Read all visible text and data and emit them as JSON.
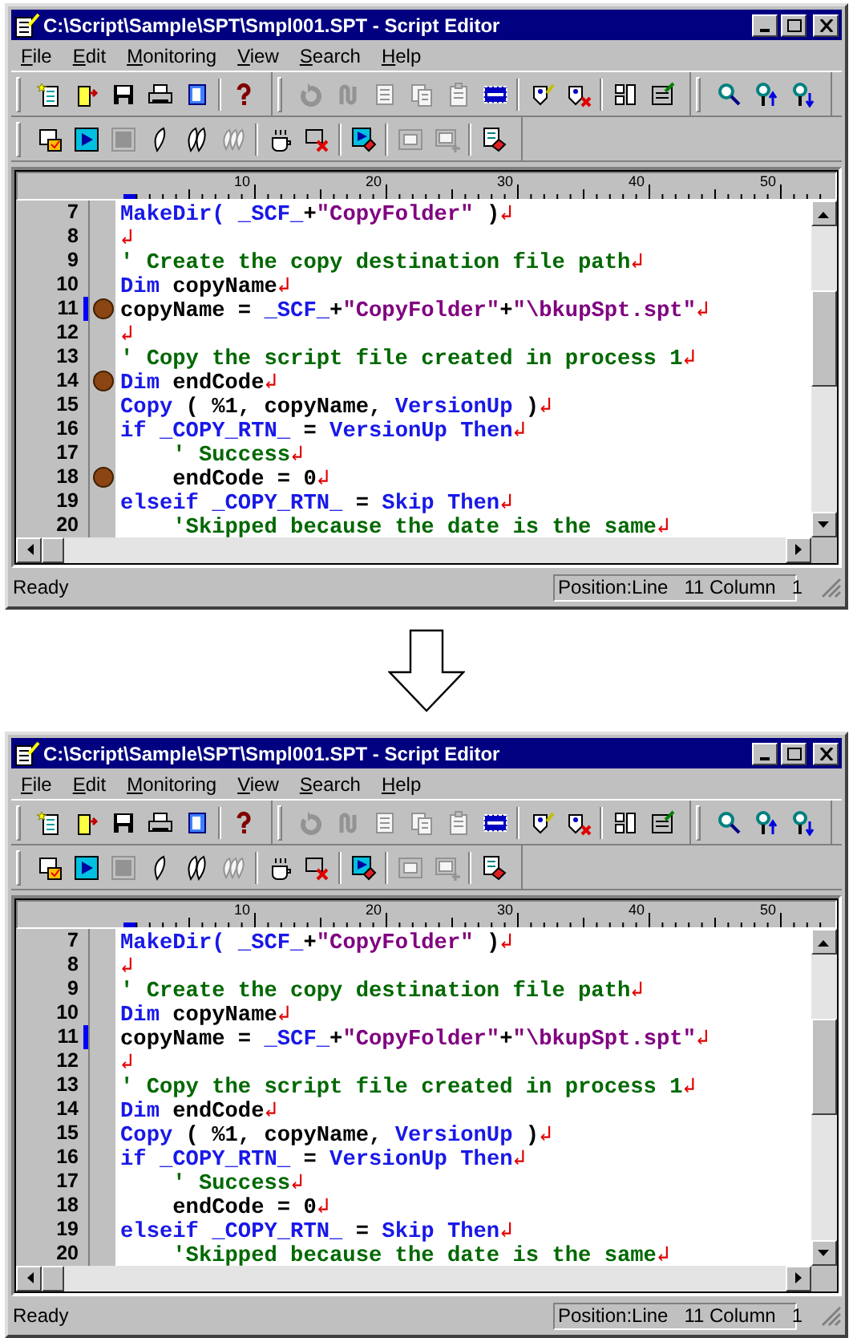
{
  "windows": [
    {
      "title": "C:\\Script\\Sample\\SPT\\Smpl001.SPT - Script Editor",
      "menu": [
        {
          "label": "File"
        },
        {
          "label": "Edit"
        },
        {
          "label": "Monitoring"
        },
        {
          "label": "View"
        },
        {
          "label": "Search"
        },
        {
          "label": "Help"
        }
      ],
      "toolbars": [
        {
          "bands": [
            {
              "groups": [
                [
                  {
                    "kind": "new",
                    "disabled": false
                  },
                  {
                    "kind": "open",
                    "disabled": false
                  },
                  {
                    "kind": "save",
                    "disabled": false
                  },
                  {
                    "kind": "print",
                    "disabled": false
                  },
                  {
                    "kind": "preview",
                    "disabled": false
                  }
                ],
                [
                  {
                    "kind": "help",
                    "disabled": false
                  }
                ]
              ]
            },
            {
              "groups": [
                [
                  {
                    "kind": "undo",
                    "disabled": true
                  },
                  {
                    "kind": "redo",
                    "disabled": true
                  },
                  {
                    "kind": "cut",
                    "disabled": true
                  },
                  {
                    "kind": "copy",
                    "disabled": true
                  },
                  {
                    "kind": "paste",
                    "disabled": true
                  },
                  {
                    "kind": "select_all",
                    "disabled": false
                  }
                ],
                [
                  {
                    "kind": "bp_set",
                    "disabled": false
                  },
                  {
                    "kind": "bp_clear",
                    "disabled": false
                  }
                ],
                [
                  {
                    "kind": "panels",
                    "disabled": false
                  },
                  {
                    "kind": "form",
                    "disabled": false
                  }
                ]
              ]
            },
            {
              "groups": [
                [
                  {
                    "kind": "find",
                    "disabled": false
                  },
                  {
                    "kind": "find_up",
                    "disabled": false
                  },
                  {
                    "kind": "find_down",
                    "disabled": false
                  }
                ]
              ]
            }
          ]
        },
        {
          "bands": [
            {
              "groups": [
                [
                  {
                    "kind": "check",
                    "disabled": false
                  },
                  {
                    "kind": "run",
                    "disabled": false
                  },
                  {
                    "kind": "stop",
                    "disabled": true
                  },
                  {
                    "kind": "step",
                    "disabled": false
                  },
                  {
                    "kind": "step_over",
                    "disabled": false
                  },
                  {
                    "kind": "step_out",
                    "disabled": true
                  }
                ],
                [
                  {
                    "kind": "pause",
                    "disabled": false
                  },
                  {
                    "kind": "cancel",
                    "disabled": false
                  }
                ],
                [
                  {
                    "kind": "run_to",
                    "disabled": false
                  }
                ],
                [
                  {
                    "kind": "watch",
                    "disabled": true
                  },
                  {
                    "kind": "watch_add",
                    "disabled": true
                  }
                ],
                [
                  {
                    "kind": "clear",
                    "disabled": false
                  }
                ]
              ]
            }
          ]
        }
      ],
      "ruler": {
        "labels": [
          "10",
          "20",
          "30",
          "40",
          "50"
        ]
      },
      "lines": [
        {
          "number": "7",
          "breakpoint": false,
          "current": false,
          "tokens": [
            {
              "kind": "keyword",
              "text": "MakeDir("
            },
            {
              "kind": "keyword",
              "text": " _SCF_"
            },
            {
              "kind": "plain",
              "text": "+"
            },
            {
              "kind": "string",
              "text": "\"CopyFolder\""
            },
            {
              "kind": "plain",
              "text": " )"
            },
            {
              "kind": "eol",
              "text": "↲"
            }
          ]
        },
        {
          "number": "8",
          "breakpoint": false,
          "current": false,
          "tokens": [
            {
              "kind": "eol",
              "text": "↲"
            }
          ]
        },
        {
          "number": "9",
          "breakpoint": false,
          "current": false,
          "tokens": [
            {
              "kind": "comment",
              "text": "' Create the copy destination file path"
            },
            {
              "kind": "eol",
              "text": "↲"
            }
          ]
        },
        {
          "number": "10",
          "breakpoint": false,
          "current": false,
          "tokens": [
            {
              "kind": "keyword",
              "text": "Dim"
            },
            {
              "kind": "plain",
              "text": " copyName"
            },
            {
              "kind": "eol",
              "text": "↲"
            }
          ]
        },
        {
          "number": "11",
          "breakpoint": true,
          "current": true,
          "tokens": [
            {
              "kind": "plain",
              "text": "copyName = "
            },
            {
              "kind": "keyword",
              "text": "_SCF_"
            },
            {
              "kind": "plain",
              "text": "+"
            },
            {
              "kind": "string",
              "text": "\"CopyFolder\""
            },
            {
              "kind": "plain",
              "text": "+"
            },
            {
              "kind": "string",
              "text": "\"\\bkupSpt.spt\""
            },
            {
              "kind": "eol",
              "text": "↲"
            }
          ]
        },
        {
          "number": "12",
          "breakpoint": false,
          "current": false,
          "tokens": [
            {
              "kind": "eol",
              "text": "↲"
            }
          ]
        },
        {
          "number": "13",
          "breakpoint": false,
          "current": false,
          "tokens": [
            {
              "kind": "comment",
              "text": "' Copy the script file created in process 1"
            },
            {
              "kind": "eol",
              "text": "↲"
            }
          ]
        },
        {
          "number": "14",
          "breakpoint": true,
          "current": false,
          "tokens": [
            {
              "kind": "keyword",
              "text": "Dim"
            },
            {
              "kind": "plain",
              "text": " endCode"
            },
            {
              "kind": "eol",
              "text": "↲"
            }
          ]
        },
        {
          "number": "15",
          "breakpoint": false,
          "current": false,
          "tokens": [
            {
              "kind": "keyword",
              "text": "Copy"
            },
            {
              "kind": "plain",
              "text": " ( %1, copyName, "
            },
            {
              "kind": "keyword",
              "text": "VersionUp"
            },
            {
              "kind": "plain",
              "text": " )"
            },
            {
              "kind": "eol",
              "text": "↲"
            }
          ]
        },
        {
          "number": "16",
          "breakpoint": false,
          "current": false,
          "tokens": [
            {
              "kind": "keyword",
              "text": "if _COPY_RTN_"
            },
            {
              "kind": "plain",
              "text": " = "
            },
            {
              "kind": "keyword",
              "text": "VersionUp Then"
            },
            {
              "kind": "eol",
              "text": "↲"
            }
          ]
        },
        {
          "number": "17",
          "breakpoint": false,
          "current": false,
          "tokens": [
            {
              "kind": "comment",
              "text": "    ' Success"
            },
            {
              "kind": "eol",
              "text": "↲"
            }
          ]
        },
        {
          "number": "18",
          "breakpoint": true,
          "current": false,
          "tokens": [
            {
              "kind": "plain",
              "text": "    endCode = 0"
            },
            {
              "kind": "eol",
              "text": "↲"
            }
          ]
        },
        {
          "number": "19",
          "breakpoint": false,
          "current": false,
          "tokens": [
            {
              "kind": "keyword",
              "text": "elseif _COPY_RTN_"
            },
            {
              "kind": "plain",
              "text": " = "
            },
            {
              "kind": "keyword",
              "text": "Skip Then"
            },
            {
              "kind": "eol",
              "text": "↲"
            }
          ]
        },
        {
          "number": "20",
          "breakpoint": false,
          "current": false,
          "tokens": [
            {
              "kind": "comment",
              "text": "    'Skipped because the date is the same"
            },
            {
              "kind": "eol",
              "text": "↲"
            }
          ]
        }
      ],
      "status": {
        "message": "Ready",
        "position": "Position:Line",
        "line": "11 Column",
        "column": "1"
      }
    },
    {
      "title": "C:\\Script\\Sample\\SPT\\Smpl001.SPT - Script Editor",
      "menu": [
        {
          "label": "File"
        },
        {
          "label": "Edit"
        },
        {
          "label": "Monitoring"
        },
        {
          "label": "View"
        },
        {
          "label": "Search"
        },
        {
          "label": "Help"
        }
      ],
      "toolbars": [
        {
          "bands": [
            {
              "groups": [
                [
                  {
                    "kind": "new",
                    "disabled": false
                  },
                  {
                    "kind": "open",
                    "disabled": false
                  },
                  {
                    "kind": "save",
                    "disabled": false
                  },
                  {
                    "kind": "print",
                    "disabled": false
                  },
                  {
                    "kind": "preview",
                    "disabled": false
                  }
                ],
                [
                  {
                    "kind": "help",
                    "disabled": false
                  }
                ]
              ]
            },
            {
              "groups": [
                [
                  {
                    "kind": "undo",
                    "disabled": true
                  },
                  {
                    "kind": "redo",
                    "disabled": true
                  },
                  {
                    "kind": "cut",
                    "disabled": true
                  },
                  {
                    "kind": "copy",
                    "disabled": true
                  },
                  {
                    "kind": "paste",
                    "disabled": true
                  },
                  {
                    "kind": "select_all",
                    "disabled": false
                  }
                ],
                [
                  {
                    "kind": "bp_set",
                    "disabled": false
                  },
                  {
                    "kind": "bp_clear",
                    "disabled": false
                  }
                ],
                [
                  {
                    "kind": "panels",
                    "disabled": false
                  },
                  {
                    "kind": "form",
                    "disabled": false
                  }
                ]
              ]
            },
            {
              "groups": [
                [
                  {
                    "kind": "find",
                    "disabled": false
                  },
                  {
                    "kind": "find_up",
                    "disabled": false
                  },
                  {
                    "kind": "find_down",
                    "disabled": false
                  }
                ]
              ]
            }
          ]
        },
        {
          "bands": [
            {
              "groups": [
                [
                  {
                    "kind": "check",
                    "disabled": false
                  },
                  {
                    "kind": "run",
                    "disabled": false
                  },
                  {
                    "kind": "stop",
                    "disabled": true
                  },
                  {
                    "kind": "step",
                    "disabled": false
                  },
                  {
                    "kind": "step_over",
                    "disabled": false
                  },
                  {
                    "kind": "step_out",
                    "disabled": true
                  }
                ],
                [
                  {
                    "kind": "pause",
                    "disabled": false
                  },
                  {
                    "kind": "cancel",
                    "disabled": false
                  }
                ],
                [
                  {
                    "kind": "run_to",
                    "disabled": false
                  }
                ],
                [
                  {
                    "kind": "watch",
                    "disabled": true
                  },
                  {
                    "kind": "watch_add",
                    "disabled": true
                  }
                ],
                [
                  {
                    "kind": "clear",
                    "disabled": false
                  }
                ]
              ]
            }
          ]
        }
      ],
      "ruler": {
        "labels": [
          "10",
          "20",
          "30",
          "40",
          "50"
        ]
      },
      "lines": [
        {
          "number": "7",
          "breakpoint": false,
          "current": false,
          "tokens": [
            {
              "kind": "keyword",
              "text": "MakeDir("
            },
            {
              "kind": "keyword",
              "text": " _SCF_"
            },
            {
              "kind": "plain",
              "text": "+"
            },
            {
              "kind": "string",
              "text": "\"CopyFolder\""
            },
            {
              "kind": "plain",
              "text": " )"
            },
            {
              "kind": "eol",
              "text": "↲"
            }
          ]
        },
        {
          "number": "8",
          "breakpoint": false,
          "current": false,
          "tokens": [
            {
              "kind": "eol",
              "text": "↲"
            }
          ]
        },
        {
          "number": "9",
          "breakpoint": false,
          "current": false,
          "tokens": [
            {
              "kind": "comment",
              "text": "' Create the copy destination file path"
            },
            {
              "kind": "eol",
              "text": "↲"
            }
          ]
        },
        {
          "number": "10",
          "breakpoint": false,
          "current": false,
          "tokens": [
            {
              "kind": "keyword",
              "text": "Dim"
            },
            {
              "kind": "plain",
              "text": " copyName"
            },
            {
              "kind": "eol",
              "text": "↲"
            }
          ]
        },
        {
          "number": "11",
          "breakpoint": false,
          "current": true,
          "tokens": [
            {
              "kind": "plain",
              "text": "copyName = "
            },
            {
              "kind": "keyword",
              "text": "_SCF_"
            },
            {
              "kind": "plain",
              "text": "+"
            },
            {
              "kind": "string",
              "text": "\"CopyFolder\""
            },
            {
              "kind": "plain",
              "text": "+"
            },
            {
              "kind": "string",
              "text": "\"\\bkupSpt.spt\""
            },
            {
              "kind": "eol",
              "text": "↲"
            }
          ]
        },
        {
          "number": "12",
          "breakpoint": false,
          "current": false,
          "tokens": [
            {
              "kind": "eol",
              "text": "↲"
            }
          ]
        },
        {
          "number": "13",
          "breakpoint": false,
          "current": false,
          "tokens": [
            {
              "kind": "comment",
              "text": "' Copy the script file created in process 1"
            },
            {
              "kind": "eol",
              "text": "↲"
            }
          ]
        },
        {
          "number": "14",
          "breakpoint": false,
          "current": false,
          "tokens": [
            {
              "kind": "keyword",
              "text": "Dim"
            },
            {
              "kind": "plain",
              "text": " endCode"
            },
            {
              "kind": "eol",
              "text": "↲"
            }
          ]
        },
        {
          "number": "15",
          "breakpoint": false,
          "current": false,
          "tokens": [
            {
              "kind": "keyword",
              "text": "Copy"
            },
            {
              "kind": "plain",
              "text": " ( %1, copyName, "
            },
            {
              "kind": "keyword",
              "text": "VersionUp"
            },
            {
              "kind": "plain",
              "text": " )"
            },
            {
              "kind": "eol",
              "text": "↲"
            }
          ]
        },
        {
          "number": "16",
          "breakpoint": false,
          "current": false,
          "tokens": [
            {
              "kind": "keyword",
              "text": "if _COPY_RTN_"
            },
            {
              "kind": "plain",
              "text": " = "
            },
            {
              "kind": "keyword",
              "text": "VersionUp Then"
            },
            {
              "kind": "eol",
              "text": "↲"
            }
          ]
        },
        {
          "number": "17",
          "breakpoint": false,
          "current": false,
          "tokens": [
            {
              "kind": "comment",
              "text": "    ' Success"
            },
            {
              "kind": "eol",
              "text": "↲"
            }
          ]
        },
        {
          "number": "18",
          "breakpoint": false,
          "current": false,
          "tokens": [
            {
              "kind": "plain",
              "text": "    endCode = 0"
            },
            {
              "kind": "eol",
              "text": "↲"
            }
          ]
        },
        {
          "number": "19",
          "breakpoint": false,
          "current": false,
          "tokens": [
            {
              "kind": "keyword",
              "text": "elseif _COPY_RTN_"
            },
            {
              "kind": "plain",
              "text": " = "
            },
            {
              "kind": "keyword",
              "text": "Skip Then"
            },
            {
              "kind": "eol",
              "text": "↲"
            }
          ]
        },
        {
          "number": "20",
          "breakpoint": false,
          "current": false,
          "tokens": [
            {
              "kind": "comment",
              "text": "    'Skipped because the date is the same"
            },
            {
              "kind": "eol",
              "text": "↲"
            }
          ]
        }
      ],
      "status": {
        "message": "Ready",
        "position": "Position:Line",
        "line": "11 Column",
        "column": "1"
      }
    }
  ]
}
